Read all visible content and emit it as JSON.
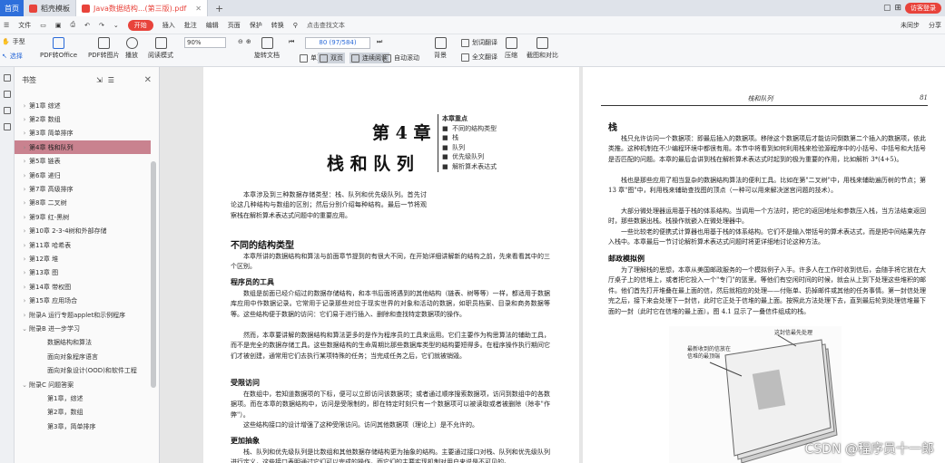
{
  "tabs": {
    "home": "首页",
    "items": [
      {
        "label": "稻壳模板",
        "color": "#e8433b"
      },
      {
        "label": "Java数据结构...(第三版).pdf",
        "color": "#e8433b"
      }
    ],
    "plus": "+",
    "login": "访客登录"
  },
  "menu": {
    "file": "文件",
    "items": [
      "开始",
      "插入",
      "批注",
      "编辑",
      "页面",
      "保护",
      "转换"
    ],
    "search": "点击查找文本",
    "sync": "未同步",
    "share": "分享"
  },
  "toolbar": {
    "hand": "手型",
    "select": "选择",
    "to_office": "PDF转Office",
    "to_image": "PDF转图片",
    "play": "播放",
    "read_mode": "阅读模式",
    "zoom": "90%",
    "page": "80 (97/584)",
    "rotate": "旋转文档",
    "single": "单页",
    "double": "双页",
    "continuous": "连续阅读",
    "auto_scroll": "自动滚动",
    "background": "背景",
    "translate_word": "划词翻译",
    "translate_full": "全文翻译",
    "compress": "压缩",
    "compare": "截图和对比"
  },
  "toc": {
    "title": "书签",
    "items": [
      {
        "label": "第1章  综述",
        "level": 0
      },
      {
        "label": "第2章  数组",
        "level": 0
      },
      {
        "label": "第3章  简单排序",
        "level": 0
      },
      {
        "label": "第4章  栈和队列",
        "level": 0,
        "selected": true
      },
      {
        "label": "第5章  链表",
        "level": 0
      },
      {
        "label": "第6章  递归",
        "level": 0
      },
      {
        "label": "第7章  高级排序",
        "level": 0
      },
      {
        "label": "第8章  二叉树",
        "level": 0
      },
      {
        "label": "第9章  红-黑树",
        "level": 0
      },
      {
        "label": "第10章  2-3-4树和外部存储",
        "level": 0
      },
      {
        "label": "第11章  哈希表",
        "level": 0
      },
      {
        "label": "第12章  堆",
        "level": 0
      },
      {
        "label": "第13章  图",
        "level": 0
      },
      {
        "label": "第14章  带权图",
        "level": 0
      },
      {
        "label": "第15章  应用场合",
        "level": 0
      },
      {
        "label": "附录A  运行专题applet和示例程序",
        "level": 0
      },
      {
        "label": "附录B  进一步学习",
        "level": 0,
        "expanded": true
      },
      {
        "label": "数据结构和算法",
        "level": 1
      },
      {
        "label": "面向对象程序语言",
        "level": 1
      },
      {
        "label": "面向对象设计(OOD)和软件工程",
        "level": 1
      },
      {
        "label": "附录C  问题答案",
        "level": 0,
        "expanded": true
      },
      {
        "label": "第1章，综述",
        "level": 1
      },
      {
        "label": "第2章，数组",
        "level": 1
      },
      {
        "label": "第3章，简单排序",
        "level": 1
      }
    ]
  },
  "page_left": {
    "chapter_num": "第 4 章",
    "chapter_title": "栈 和 队 列",
    "key_title": "本章重点",
    "key_points": [
      "不同的结构类型",
      "栈",
      "队列",
      "优先级队列",
      "解析算术表达式"
    ],
    "intro": "本章涉及到三种数据存储类型：栈、队列和优先级队列。首先讨论这几种结构与数组的区别；然后分别介绍每种结构。最后一节将观察栈在解析算术表达式问题中的重要应用。",
    "h_types": "不同的结构类型",
    "p_types": "本章所讲的数据结构和算法与前面章节提到的有很大不同，在开始详细讲解新的结构之前，先来看看其中的三个区别。",
    "h_tools": "程序员的工具",
    "p_tools1": "数组是前面已经介绍过的数据存储结构，和本书后面将遇到的其他结构（链表、树等等）一样，都适用于数据库应用中作数据记录。它常用于记录那些对应于现实世界的对象和活动的数据，如职员档案、目录和商务数据等等。这些结构便于数据的访问：它们易于进行插入、删除和查找特定数据项的操作。",
    "p_tools2": "然而，本章要讲解的数据结构和算法更多的是作为程序员的工具来运用。它们主要作为构思算法的辅助工具，而不是完全的数据存储工具。这些数据结构的生命周期比那些数据库类型的结构要短得多。在程序操作执行期间它们才被创建，通常用它们去执行某项特殊的任务；当完成任务之后，它们就被销毁。",
    "h_access": "受限访问",
    "p_access1": "在数组中，若知道数据项的下标，便可以立即访问该数据项；或者通过顺序搜索数据项，访问到数组中的各数据项。而在本章的数据结构中，访问是受限制的，即在特定时刻只有一个数据项可以被读取或者被删除（除非\"作弊\"）。",
    "p_access2": "这些结构接口的设计增强了这种受限访问。访问其他数据项（理论上）是不允许的。",
    "h_abstract": "更加抽象",
    "p_abstract": "栈、队列和优先级队列是比数组和其他数据存储结构更为抽象的结构。主要通过接口对栈、队列和优先级队列进行定义，这些接口表明通过它们可以完成的操作，而它们的主要实现机制对用户来说是不可见的。"
  },
  "page_right": {
    "header_title": "栈和队列",
    "page_number": "81",
    "h_stack": "栈",
    "p_stack1": "栈只允许访问一个数据项：即最后插入的数据项。移除这个数据项后才能访问倒数第二个插入的数据项，依此类推。这种机制在不少编程环境中都很有用。本节中将看到如何利用栈来检验源程序中的小括号、中括号和大括号是否匹配的问题。本章的最后会讲到栈在解析算术表达式时起到的极为重要的作用，比如解析 3*(4+5)。",
    "p_stack2": "栈也是那些应用了相当复杂的数据结构算法的便利工具。比如在第\"二叉树\"中，用栈来辅助遍历树的节点；第 13 章\"图\"中，利用栈来辅助查找图的顶点（一种可以用来解决迷宫问题的技术）。",
    "p_stack3": "大部分微处理器运用基于栈的体系结构。当调用一个方法时，把它的返回地址和参数压入栈，当方法结束返回时，那些数据出栈。栈操作就嵌入在微处理器中。",
    "p_stack4": "一些比较老的便携式计算器也用基于栈的体系结构。它们不是输入带括号的算术表达式，而是把中间结果先存入栈中。本章最后一节讨论解析算术表达式问题时将更详细地讨论这种方法。",
    "h_mail": "邮政模拟例",
    "p_mail": "为了理解栈的思想，本章从美国邮政服务的一个模拟例子入手。许多人在工作时收到信后，会随手将它放在大厅桌子上的信堆上，或者把它投入一个\"专门\"的篮里。等他们有空闲时间的时候，就会从上到下处理这些堆积的邮件。他们首先打开堆叠在最上面的信，然后就相应的处理——付账单、扔掉邮件或其他的任务事情。第一封信处理完之后，接下来会处理下一封信，此时它正处于信堆的最上面。按照此方法处理下去，直到最后轮到处理信堆最下面的一封（此时它在信堆的最上面）。图 4.1 显示了一叠信件组成的栈。",
    "fig_label_top": "这封信最先处理",
    "fig_label_mid": "最新收到的信放在信堆的最顶端"
  },
  "watermark": "CSDN @程序员十一郎"
}
